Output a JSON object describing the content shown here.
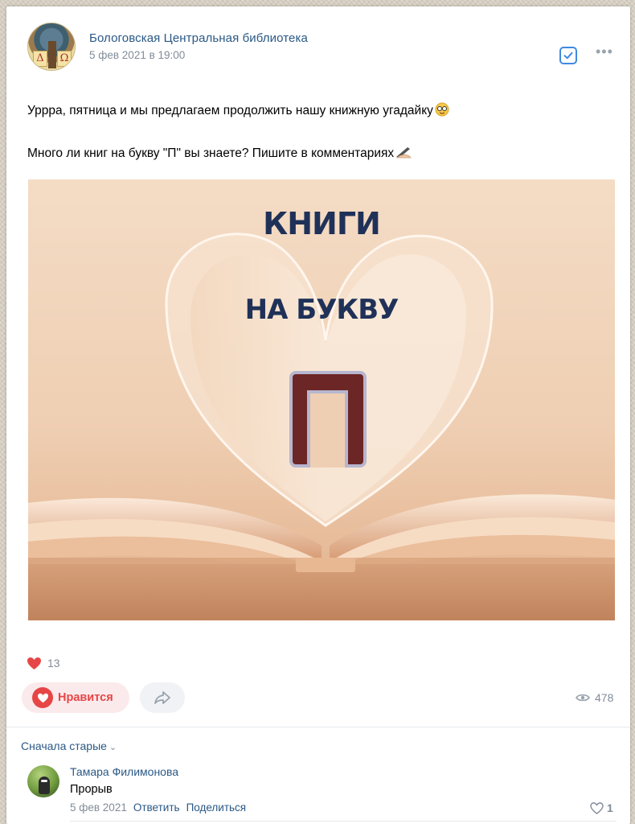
{
  "post": {
    "author": "Бологовская Центральная библиотека",
    "date": "5 фев 2021 в 19:00",
    "text_line1": "Уррра, пятница и мы предлагаем продолжить нашу книжную угадайку",
    "text_line2": "Много ли книг на букву \"П\" вы знаете? Пишите в комментариях",
    "image": {
      "title_line1": "КНИГИ",
      "title_line2": "НА БУКВУ",
      "letter": "П"
    },
    "avatar_letters": [
      "Δ",
      "Ω"
    ],
    "likes_count": "13",
    "like_label": "Нравится",
    "views": "478"
  },
  "comments": {
    "sort_label": "Сначала старые",
    "items": [
      {
        "author": "Тамара Филимонова",
        "text": "Прорыв",
        "date": "5 фев 2021",
        "reply": "Ответить",
        "share": "Поделиться",
        "likes": "1"
      }
    ]
  },
  "colors": {
    "link": "#2a5885",
    "like_red": "#e64646",
    "muted": "#818c99",
    "letter_maroon": "#6d2626",
    "title_navy": "#1f3158"
  },
  "icons": [
    "check-square-icon",
    "more-dots-icon",
    "heart-icon",
    "share-arrow-icon",
    "eye-icon",
    "chevron-down-icon"
  ]
}
